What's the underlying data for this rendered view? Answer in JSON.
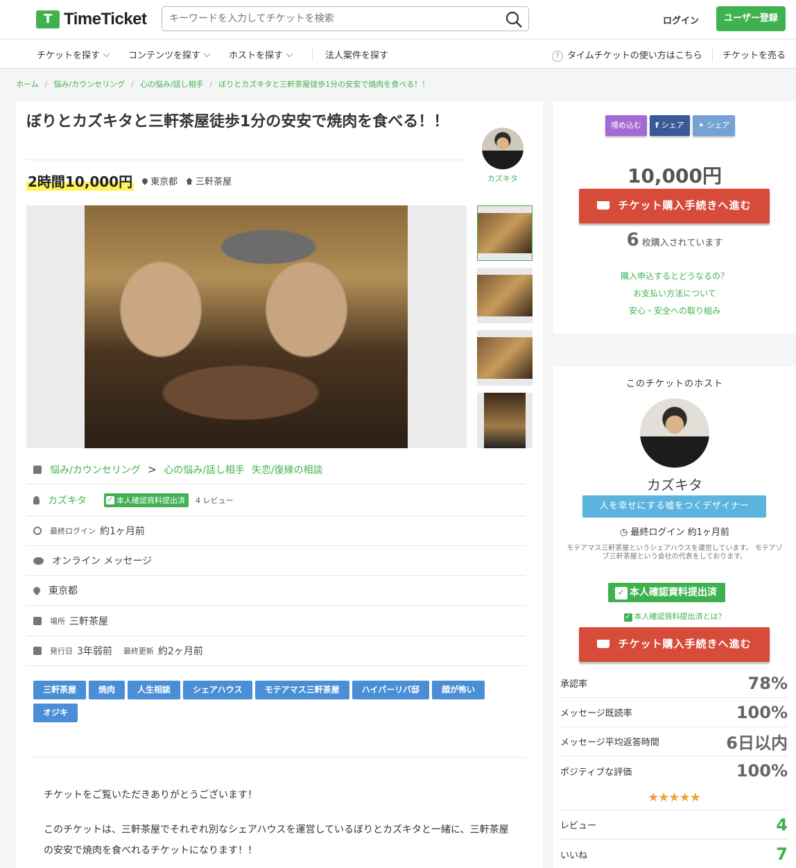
{
  "header": {
    "logo_text": "TimeTicket",
    "logo_mark": "T",
    "search_placeholder": "キーワードを入力してチケットを検索",
    "login": "ログイン",
    "register": "ユーザー登録"
  },
  "nav": {
    "find_ticket": "チケットを探す",
    "contents": "コンテンツを探す",
    "find_host": "ホストを探す",
    "corporate": "法人案件を探す",
    "howto": "タイムチケットの使い方はこちら",
    "sell": "チケットを売る"
  },
  "breadcrumb": [
    "ホーム",
    "悩み/カウンセリング",
    "心の悩み/話し相手",
    "ぼりとカズキタと三軒茶屋徒歩1分の安安で焼肉を食べる！！"
  ],
  "ticket": {
    "title": "ぼりとカズキタと三軒茶屋徒歩1分の安安で焼肉を食べる！！",
    "price": "2時間10,000円",
    "area": "東京都",
    "place": "三軒茶屋",
    "host_name": "カズキタ",
    "category1": "悩み/カウンセリング",
    "category2": "心の悩み/話し相手",
    "category3": "失恋/復縁の相談",
    "verified": "本人確認資料提出済",
    "reviews": "4 レビュー",
    "last_login_label": "最終ログイン",
    "last_login": "約1ヶ月前",
    "format": "オンライン メッセージ",
    "location_label": "場所",
    "issued_label": "発行日",
    "issued": "3年弱前",
    "updated_label": "最終更新",
    "updated": "約2ヶ月前"
  },
  "tags": [
    "三軒茶屋",
    "焼肉",
    "人生相談",
    "シェアハウス",
    "モテアマス三軒茶屋",
    "ハイパーリバ邸",
    "顔が怖い",
    "オジキ"
  ],
  "description": [
    "チケットをご覧いただきありがとうございます！",
    "このチケットは、三軒茶屋でそれぞれ別なシェアハウスを運営しているぼりとカズキタと一緒に、三軒茶屋の安安で焼肉を食べれるチケットになります！！"
  ],
  "side": {
    "embed": "埋め込む",
    "share_fb": "シェア",
    "share_tw": "シェア",
    "price": "10,000円",
    "buy": "チケット購入手続きへ進む",
    "sold_count": "6",
    "sold_text": "枚購入されています",
    "links": [
      "購入申込するとどうなるの？",
      "お支払い方法について",
      "安心・安全への取り組み"
    ]
  },
  "host": {
    "heading": "このチケットのホスト",
    "name": "カズキタ",
    "catchphrase": "人を幸せにする嘘をつくデザイナー",
    "last_login": "最終ログイン 約1ヶ月前",
    "bio": "モテアマス三軒茶屋というシェアハウスを運営しています。 モテアゾブ三軒茶屋という会社の代表をしております。",
    "verified": "本人確認資料提出済",
    "verified_q": "本人確認資料提出済とは？",
    "stats": [
      {
        "label": "承認率",
        "value": "78%"
      },
      {
        "label": "メッセージ既読率",
        "value": "100%"
      },
      {
        "label": "メッセージ平均返答時間",
        "value": "6日以内"
      },
      {
        "label": "ポジティブな評価",
        "value": "100%"
      }
    ],
    "stars": "★★★★★",
    "review_label": "レビュー",
    "review_count": "4",
    "like_label": "いいね",
    "like_count": "7"
  },
  "colors": {
    "brand_green": "#3fb24f",
    "buy_red": "#d74b3b",
    "tag_blue": "#4a8ed6",
    "catch_blue": "#5bb3de"
  }
}
